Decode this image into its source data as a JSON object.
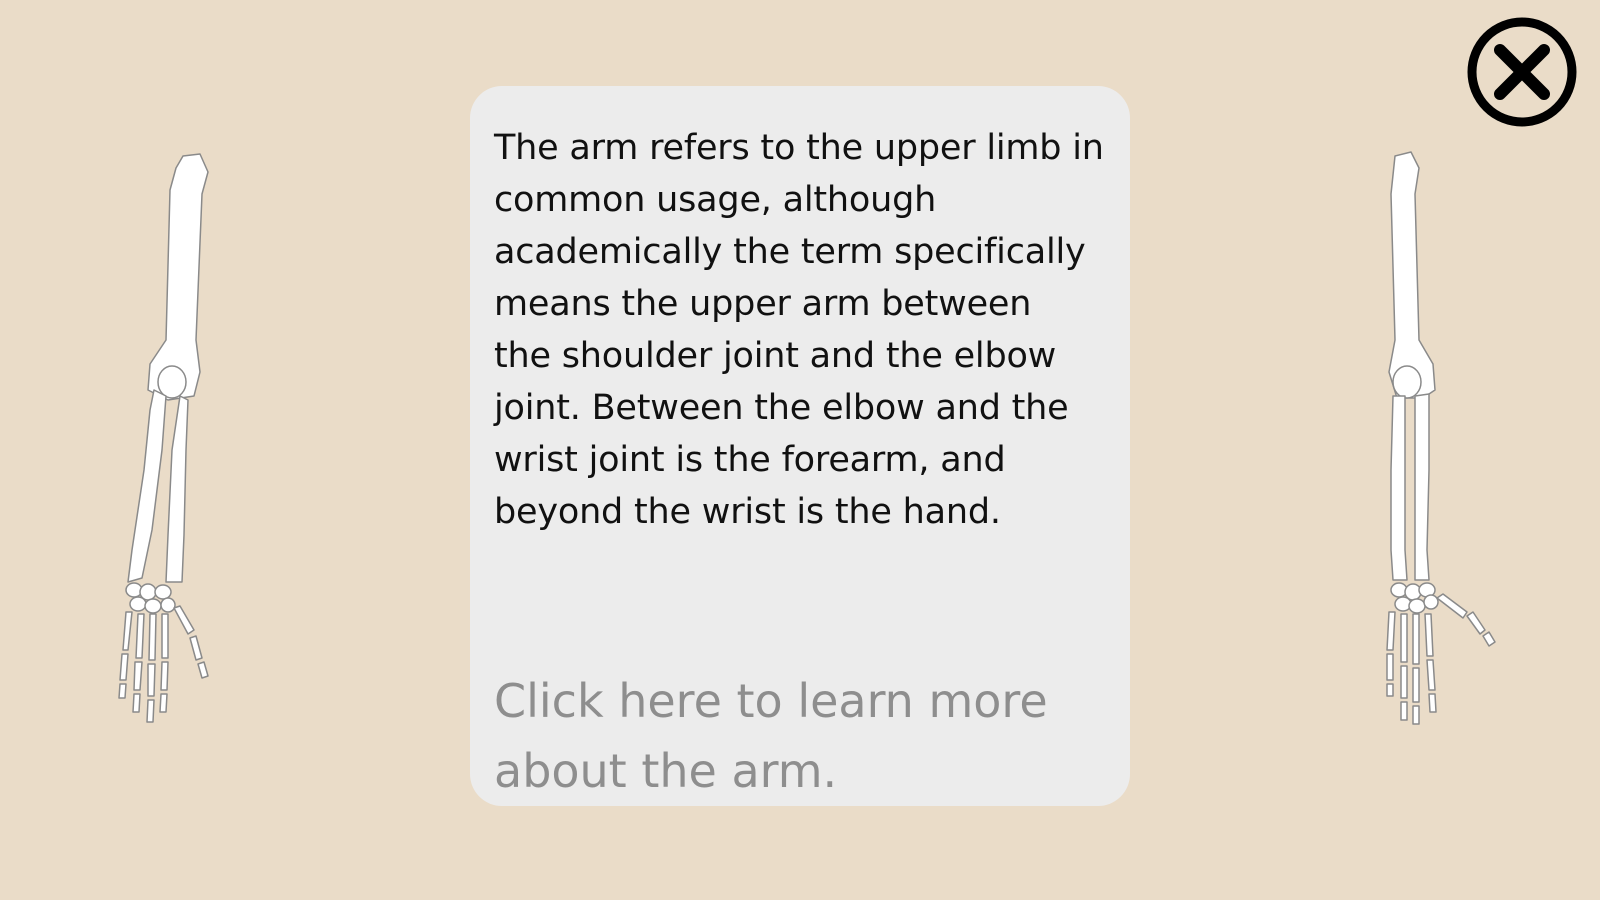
{
  "info_card": {
    "description": "The arm refers to the upper limb in\ncommon usage, although\nacademically the term specifically\nmeans the upper arm between\nthe shoulder joint and the elbow\njoint. Between the elbow and the\nwrist joint is the forearm, and\nbeyond the wrist is the hand.",
    "learn_more": "Click here to learn more\nabout the arm."
  },
  "icons": {
    "close": "close-icon",
    "arm_left": "arm-bones-illustration",
    "arm_right": "arm-bones-illustration"
  },
  "colors": {
    "background": "#eadcc8",
    "card": "#ececec",
    "text": "#111111",
    "link_text": "#8e8e8e",
    "icon": "#000000"
  }
}
